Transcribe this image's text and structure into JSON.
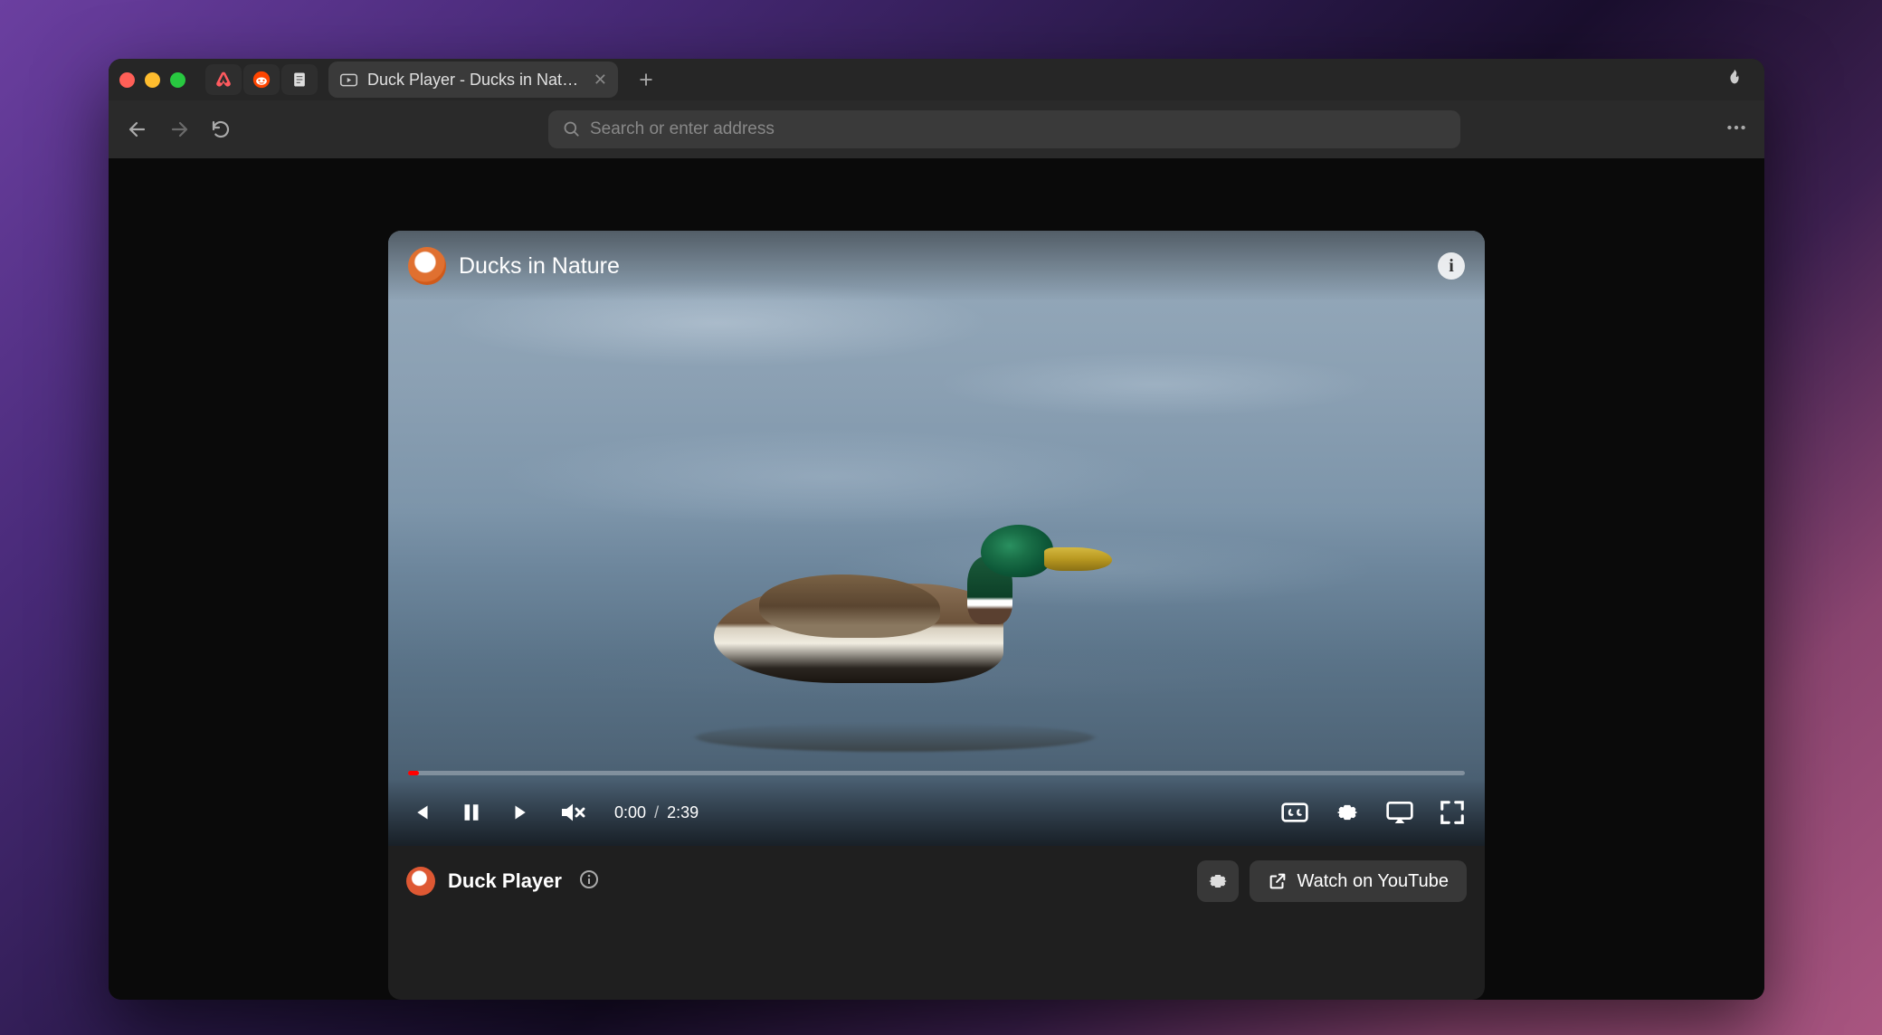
{
  "browser": {
    "tab_title": "Duck Player - Ducks in Nature",
    "address_placeholder": "Search or enter address"
  },
  "video": {
    "title": "Ducks in Nature",
    "current_time": "0:00",
    "time_separator": "/",
    "total_time": "2:39",
    "progress_percent": 1
  },
  "bottom": {
    "player_label": "Duck Player",
    "watch_label": "Watch on YouTube"
  }
}
